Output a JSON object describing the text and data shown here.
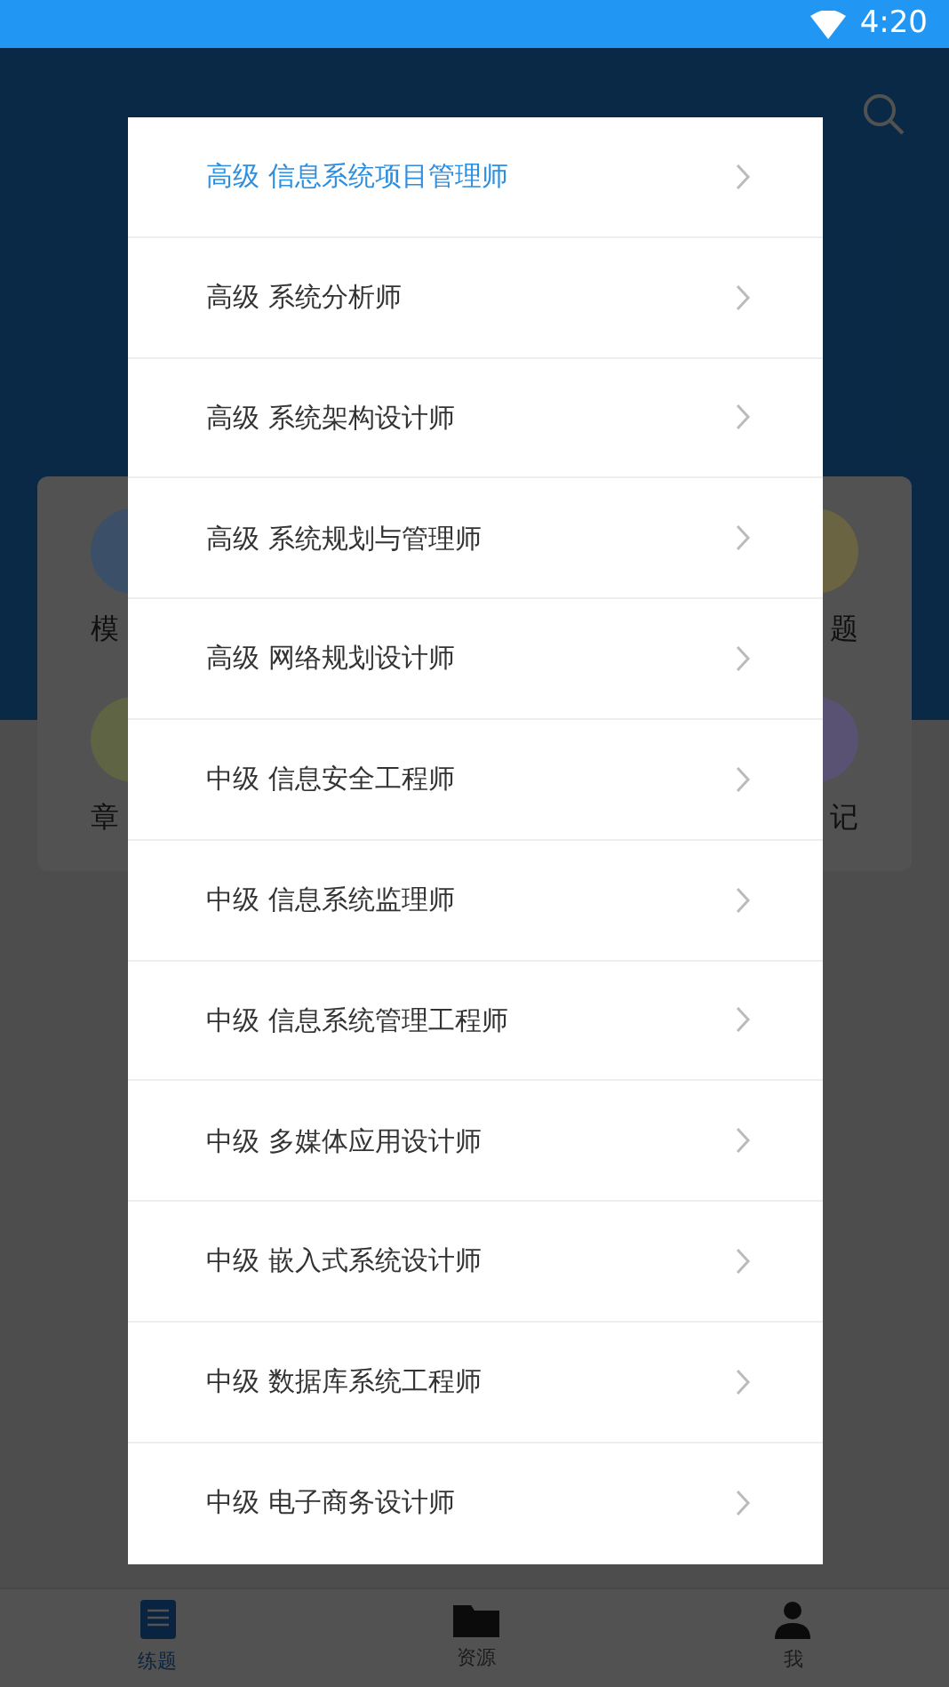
{
  "status_bar": {
    "time": "4:20"
  },
  "shortcuts": [
    {
      "label": "模",
      "color": "#3c4f68"
    },
    {
      "label": "题",
      "color": "#6b6442"
    },
    {
      "label": "章",
      "color": "#5e6444"
    },
    {
      "label": "记",
      "color": "#5a5272"
    }
  ],
  "exam_menu": [
    {
      "label": "高级 信息系统项目管理师",
      "selected": true
    },
    {
      "label": "高级 系统分析师",
      "selected": false
    },
    {
      "label": "高级 系统架构设计师",
      "selected": false
    },
    {
      "label": "高级 系统规划与管理师",
      "selected": false
    },
    {
      "label": "高级 网络规划设计师",
      "selected": false
    },
    {
      "label": "中级 信息安全工程师",
      "selected": false
    },
    {
      "label": "中级 信息系统监理师",
      "selected": false
    },
    {
      "label": "中级 信息系统管理工程师",
      "selected": false
    },
    {
      "label": "中级 多媒体应用设计师",
      "selected": false
    },
    {
      "label": "中级 嵌入式系统设计师",
      "selected": false
    },
    {
      "label": "中级 数据库系统工程师",
      "selected": false
    },
    {
      "label": "中级 电子商务设计师",
      "selected": false
    }
  ],
  "tabs": [
    {
      "label": "练题",
      "selected": true,
      "kind": "book"
    },
    {
      "label": "资源",
      "selected": false,
      "kind": "folder"
    },
    {
      "label": "我",
      "selected": false,
      "kind": "person"
    }
  ]
}
